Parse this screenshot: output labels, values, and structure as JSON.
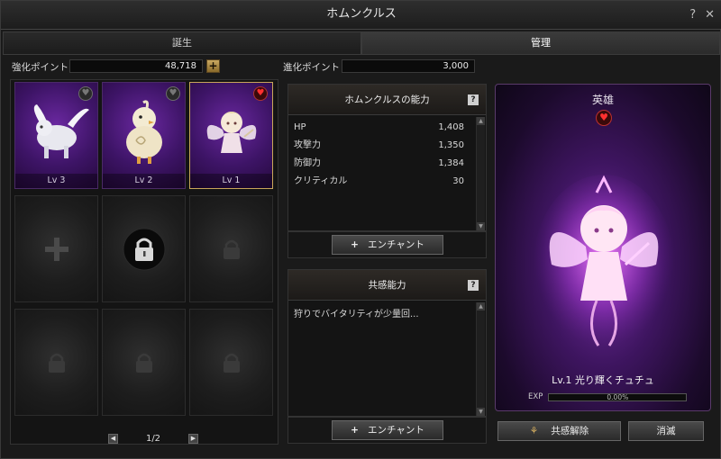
{
  "window": {
    "title": "ホムンクルス",
    "help_btn": "?",
    "close_btn": "✕"
  },
  "tabs": [
    {
      "label": "誕生",
      "active": false
    },
    {
      "label": "管理",
      "active": true
    }
  ],
  "points": {
    "enhance_label": "強化ポイント",
    "enhance_value": "48,718",
    "evolve_label": "進化ポイント",
    "evolve_value": "3,000"
  },
  "slots": [
    {
      "level": "Lv 3",
      "favorite": false
    },
    {
      "level": "Lv 2",
      "favorite": false
    },
    {
      "level": "Lv 1",
      "favorite": true,
      "selected": true
    }
  ],
  "pager": {
    "text": "1/2"
  },
  "abilities": {
    "title": "ホムンクルスの能力",
    "stats": [
      {
        "name": "HP",
        "value": "1,408"
      },
      {
        "name": "攻撃力",
        "value": "1,350"
      },
      {
        "name": "防御力",
        "value": "1,384"
      },
      {
        "name": "クリティカル",
        "value": "30"
      }
    ],
    "enchant_label": "エンチャント"
  },
  "sympathy": {
    "title": "共感能力",
    "description": "狩りでバイタリティが少量回...",
    "enchant_label": "エンチャント"
  },
  "hero": {
    "label": "英雄",
    "name": "Lv.1 光り輝くチュチュ",
    "exp_label": "EXP",
    "exp_value": "0.00%"
  },
  "buttons": {
    "release": "共感解除",
    "dismiss": "消滅"
  },
  "colors": {
    "accent_purple": "#7a2fa8",
    "gold": "#c9a65a",
    "heart_red": "#ff3030"
  }
}
